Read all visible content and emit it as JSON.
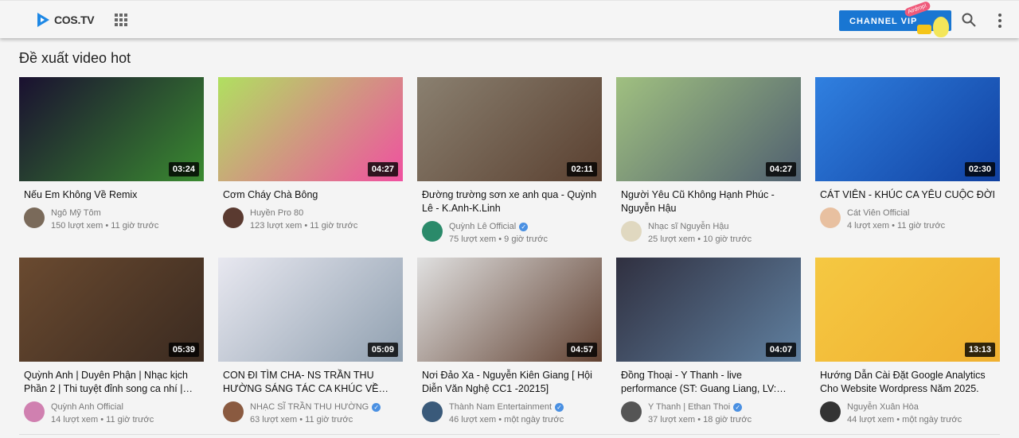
{
  "header": {
    "logo": "COS.TV",
    "vip_button": "CHANNEL VIP",
    "vip_badge": "Airdrop!"
  },
  "section_title": "Đề xuất video hot",
  "videos": [
    {
      "title": "Nếu Em Không Về Remix",
      "channel": "Ngô Mỹ Tôm",
      "stats": "150 lượt xem • 11 giờ trước",
      "duration": "03:24",
      "verified": false,
      "thumb": [
        "#1a1030",
        "#3a8a30"
      ],
      "avatar": "#7a6a5a"
    },
    {
      "title": "Cơm Cháy Chà Bông",
      "channel": "Huyền Pro 80",
      "stats": "123 lượt xem • 11 giờ trước",
      "duration": "04:27",
      "verified": false,
      "thumb": [
        "#b0e060",
        "#f050a0"
      ],
      "avatar": "#5a3a30"
    },
    {
      "title": "Đường trường sơn xe anh qua - Quỳnh Lê - K.Anh-K.Linh",
      "channel": "Quỳnh Lê Official",
      "stats": "75 lượt xem • 9 giờ trước",
      "duration": "02:11",
      "verified": true,
      "thumb": [
        "#8a8070",
        "#5a4030"
      ],
      "avatar": "#2a8a6a"
    },
    {
      "title": "Người Yêu Cũ Không Hạnh Phúc - Nguyễn Hậu",
      "channel": "Nhạc sĩ Nguyễn Hậu",
      "stats": "25 lượt xem • 10 giờ trước",
      "duration": "04:27",
      "verified": false,
      "thumb": [
        "#a0c080",
        "#506070"
      ],
      "avatar": "#e0d8c0"
    },
    {
      "title": "CÁT VIÊN - KHÚC CA YÊU CUỘC ĐỜI",
      "channel": "Cát Viên Official",
      "stats": "4 lượt xem • 11 giờ trước",
      "duration": "02:30",
      "verified": false,
      "thumb": [
        "#3080e0",
        "#1040a0"
      ],
      "avatar": "#e8c0a0"
    },
    {
      "title": "Quỳnh Anh | Duyên Phận | Nhạc kịch Phần 2 | Thi tuyệt đỉnh song ca nhí | Di...",
      "channel": "Quỳnh Anh Official",
      "stats": "14 lượt xem • 11 giờ trước",
      "duration": "05:39",
      "verified": false,
      "thumb": [
        "#6a4a30",
        "#3a2a20"
      ],
      "avatar": "#d080b0"
    },
    {
      "title": "CON ĐI TÌM CHA- NS TRẦN THU HƯỜNG SÁNG TÁC CA KHÚC VỀ CHA-...",
      "channel": "NHẠC SĨ TRẦN THU HƯỜNG",
      "stats": "63 lượt xem • 11 giờ trước",
      "duration": "05:09",
      "verified": true,
      "thumb": [
        "#e8e8f0",
        "#90a0b0"
      ],
      "avatar": "#8a5a40"
    },
    {
      "title": "Nơi Đảo Xa - Nguyễn Kiên Giang [ Hội Diễn Văn Nghệ CC1 -20215]",
      "channel": "Thành Nam Entertainment",
      "stats": "46 lượt xem • một ngày trước",
      "duration": "04:57",
      "verified": true,
      "thumb": [
        "#e0e0e0",
        "#604030"
      ],
      "avatar": "#3a5a7a"
    },
    {
      "title": "Đồng Thoại - Y Thanh - live performance (ST: Guang Liang, LV: Công Nguyễn) -...",
      "channel": "Y Thanh | Ethan Thoi",
      "stats": "37 lượt xem • 18 giờ trước",
      "duration": "04:07",
      "verified": true,
      "thumb": [
        "#303040",
        "#6080a0"
      ],
      "avatar": "#555"
    },
    {
      "title": "Hướng Dẫn Cài Đặt Google Analytics Cho Website Wordpress Năm 2025.",
      "channel": "Nguyễn Xuân Hòa",
      "stats": "44 lượt xem • một ngày trước",
      "duration": "13:13",
      "verified": false,
      "thumb": [
        "#f5c842",
        "#f0b030"
      ],
      "avatar": "#333"
    }
  ]
}
